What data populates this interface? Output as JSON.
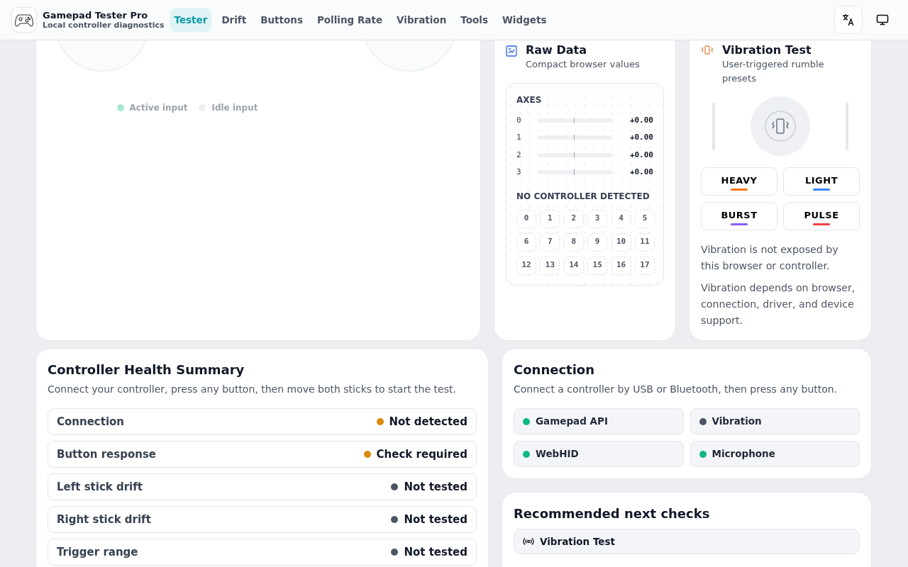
{
  "app": {
    "title": "Gamepad Tester Pro",
    "subtitle": "Local controller diagnostics"
  },
  "nav": [
    {
      "label": "Tester",
      "selected": true
    },
    {
      "label": "Drift",
      "selected": false
    },
    {
      "label": "Buttons",
      "selected": false
    },
    {
      "label": "Polling Rate",
      "selected": false
    },
    {
      "label": "Vibration",
      "selected": false
    },
    {
      "label": "Tools",
      "selected": false
    },
    {
      "label": "Widgets",
      "selected": false
    }
  ],
  "stick_panel": {
    "legend": [
      {
        "label": "Active input",
        "color": "#a7e8d2"
      },
      {
        "label": "Idle input",
        "color": "#eceef2"
      }
    ]
  },
  "raw_data": {
    "title": "Raw Data",
    "subtitle": "Compact browser values",
    "axes_heading": "AXES",
    "axes": [
      {
        "index": "0",
        "value": "+0.00"
      },
      {
        "index": "1",
        "value": "+0.00"
      },
      {
        "index": "2",
        "value": "+0.00"
      },
      {
        "index": "3",
        "value": "+0.00"
      }
    ],
    "buttons_heading": "NO CONTROLLER DETECTED",
    "buttons": [
      "0",
      "1",
      "2",
      "3",
      "4",
      "5",
      "6",
      "7",
      "8",
      "9",
      "10",
      "11",
      "12",
      "13",
      "14",
      "15",
      "16",
      "17"
    ]
  },
  "vibration": {
    "title": "Vibration Test",
    "subtitle": "User-triggered rumble presets",
    "presets": [
      {
        "label": "HEAVY",
        "color": "#f97316"
      },
      {
        "label": "LIGHT",
        "color": "#3b82f6"
      },
      {
        "label": "BURST",
        "color": "#8b5cf6"
      },
      {
        "label": "PULSE",
        "color": "#ef4444"
      }
    ],
    "notes": [
      "Vibration is not exposed by this browser or controller.",
      "Vibration depends on browser, connection, driver, and device support."
    ]
  },
  "health": {
    "title": "Controller Health Summary",
    "subtitle": "Connect your controller, press any button, then move both sticks to start the test.",
    "rows": [
      {
        "label": "Connection",
        "status": "Not detected",
        "color": "#d98a0b"
      },
      {
        "label": "Button response",
        "status": "Check required",
        "color": "#d98a0b"
      },
      {
        "label": "Left stick drift",
        "status": "Not tested",
        "color": "#4b5563"
      },
      {
        "label": "Right stick drift",
        "status": "Not tested",
        "color": "#4b5563"
      },
      {
        "label": "Trigger range",
        "status": "Not tested",
        "color": "#4b5563"
      }
    ]
  },
  "connection": {
    "title": "Connection",
    "subtitle": "Connect a controller by USB or Bluetooth, then press any button.",
    "features": [
      {
        "label": "Gamepad API",
        "color": "#10b981"
      },
      {
        "label": "Vibration",
        "color": "#4b5563"
      },
      {
        "label": "WebHID",
        "color": "#10b981"
      },
      {
        "label": "Microphone",
        "color": "#10b981"
      }
    ]
  },
  "recommended": {
    "title": "Recommended next checks",
    "items": [
      {
        "label": "Vibration Test"
      }
    ]
  }
}
